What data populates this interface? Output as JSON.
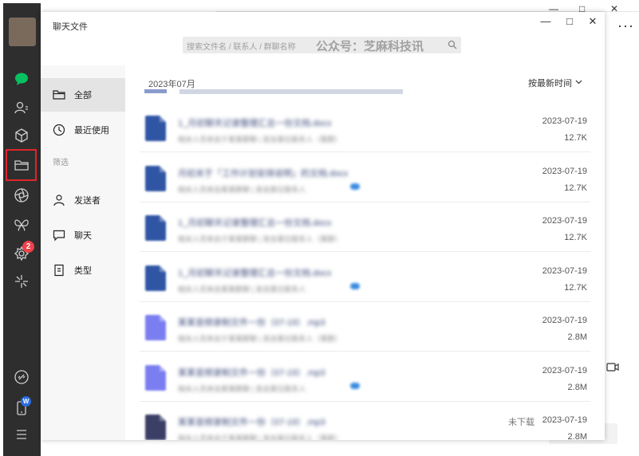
{
  "background": {
    "window_controls": [
      "—",
      "□",
      "✕"
    ],
    "more_icon": "more-horizontal-icon",
    "video_icon": "video-call-icon"
  },
  "sidebar": {
    "icons": [
      "chat-icon",
      "contacts-icon",
      "cube-icon",
      "folder-icon",
      "aperture-icon",
      "butterfly-icon",
      "settings-gear-icon",
      "sparkle-icon",
      "link-icon",
      "phone-icon",
      "menu-icon"
    ],
    "badge_count": "2",
    "phone_badge": "W"
  },
  "dialog": {
    "title": "聊天文件",
    "controls": {
      "minimize": "—",
      "maximize": "□",
      "close": "✕"
    },
    "search_placeholder": "搜索文件名 / 联系人 / 群聊名称",
    "watermark": "公众号：芝麻科技讯"
  },
  "nav": {
    "all": "全部",
    "recent": "最近使用",
    "filter_heading": "筛选",
    "sender": "发送者",
    "chat": "聊天",
    "type": "类型"
  },
  "list": {
    "month": "2023年07月",
    "sort_label": "按最新时间",
    "files": [
      {
        "name": "1_月初聊天记录整理汇总一份文档.docx",
        "meta": "相关人员来自于某某群聊 | 发自某位联系人（某群）",
        "date": "2023-07-19",
        "size": "12.7K",
        "type": "doc",
        "status": ""
      },
      {
        "name": "月初关于「工作计划安排说明」的文档.docx",
        "meta": "相关人员来自某某群聊 | 发自某位联系人",
        "date": "2023-07-19",
        "size": "12.7K",
        "type": "doc",
        "status": ""
      },
      {
        "name": "1_月初聊天记录整理汇总一份文档.docx",
        "meta": "相关人员来自于某某群聊 | 发自某位联系人（某群）",
        "date": "2023-07-19",
        "size": "12.7K",
        "type": "doc",
        "status": ""
      },
      {
        "name": "1_月初聊天记录整理汇总一份文档.docx",
        "meta": "相关人员来自某某群聊 | 发自某位联系人",
        "date": "2023-07-19",
        "size": "12.7K",
        "type": "doc",
        "status": ""
      },
      {
        "name": "某某音频录制文件一份（07-19）.mp3",
        "meta": "相关人员来自于某某群聊 | 发自某位联系人（某群）",
        "date": "2023-07-19",
        "size": "2.8M",
        "type": "audio",
        "status": ""
      },
      {
        "name": "某某音频录制文件一份（07-19）.mp3",
        "meta": "相关人员来自某某群聊 | 发自某位联系人",
        "date": "2023-07-19",
        "size": "2.8M",
        "type": "audio",
        "status": ""
      },
      {
        "name": "某某音频录制文件一份（07-19）.mp3",
        "meta": "相关人员来自于某某群聊 | 发自某位联系人（某群）",
        "date": "2023-07-19",
        "size": "2.8M",
        "type": "archive",
        "status": "未下载"
      }
    ]
  }
}
